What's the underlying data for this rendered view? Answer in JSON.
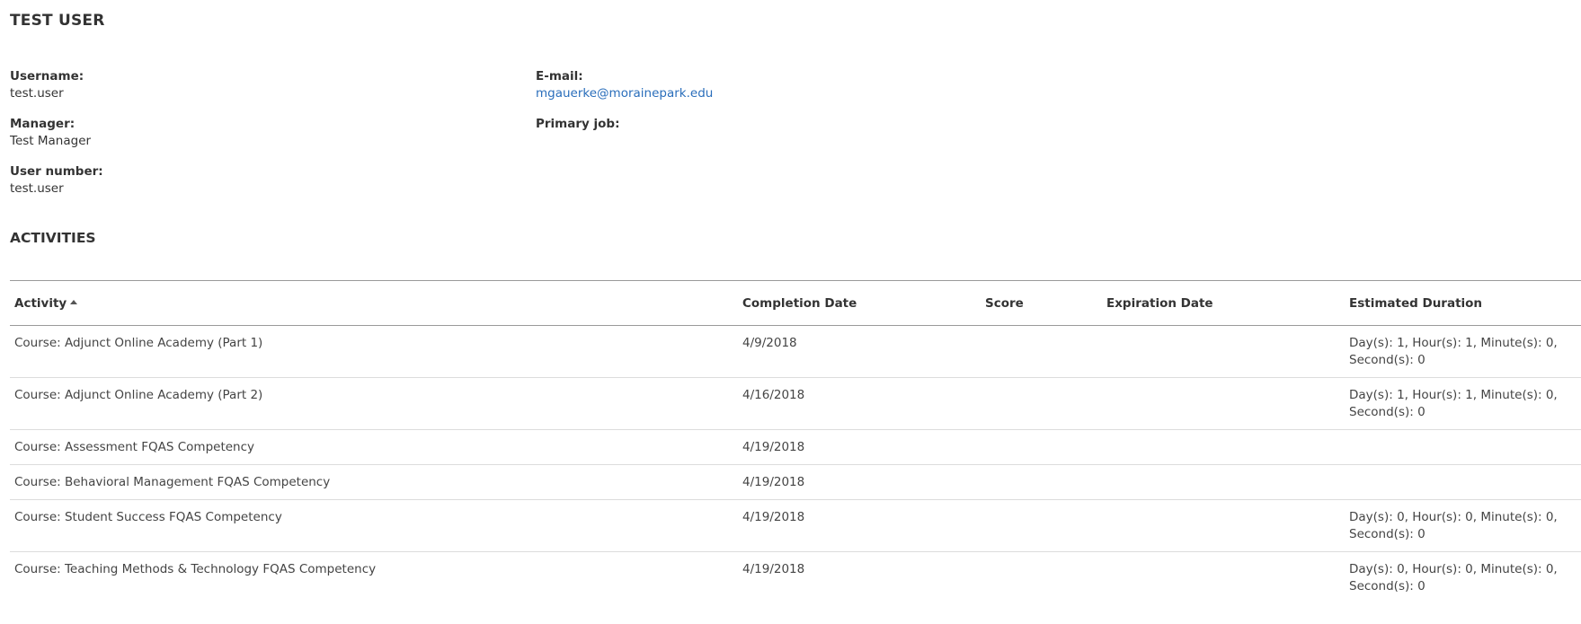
{
  "user": {
    "display_name": "TEST USER"
  },
  "profile": {
    "username_label": "Username:",
    "username_value": "test.user",
    "manager_label": "Manager:",
    "manager_value": "Test Manager",
    "user_number_label": "User number:",
    "user_number_value": "test.user",
    "email_label": "E-mail:",
    "email_value": "mgauerke@morainepark.edu",
    "primary_job_label": "Primary job:",
    "primary_job_value": ""
  },
  "activities": {
    "section_title": "ACTIVITIES",
    "columns": [
      "Activity",
      "Completion Date",
      "Score",
      "Expiration Date",
      "Estimated Duration"
    ],
    "sort": {
      "column": "Activity",
      "direction": "ascending"
    },
    "rows": [
      {
        "activity": "Course: Adjunct Online Academy (Part 1)",
        "completion_date": "4/9/2018",
        "score": "",
        "expiration_date": "",
        "estimated_duration": "Day(s): 1, Hour(s): 1, Minute(s): 0, Second(s): 0"
      },
      {
        "activity": "Course: Adjunct Online Academy (Part 2)",
        "completion_date": "4/16/2018",
        "score": "",
        "expiration_date": "",
        "estimated_duration": "Day(s): 1, Hour(s): 1, Minute(s): 0, Second(s): 0"
      },
      {
        "activity": "Course: Assessment FQAS Competency",
        "completion_date": "4/19/2018",
        "score": "",
        "expiration_date": "",
        "estimated_duration": ""
      },
      {
        "activity": "Course: Behavioral Management FQAS Competency",
        "completion_date": "4/19/2018",
        "score": "",
        "expiration_date": "",
        "estimated_duration": ""
      },
      {
        "activity": "Course: Student Success FQAS Competency",
        "completion_date": "4/19/2018",
        "score": "",
        "expiration_date": "",
        "estimated_duration": "Day(s): 0, Hour(s): 0, Minute(s): 0, Second(s): 0"
      },
      {
        "activity": "Course: Teaching Methods & Technology FQAS Competency",
        "completion_date": "4/19/2018",
        "score": "",
        "expiration_date": "",
        "estimated_duration": "Day(s): 0, Hour(s): 0, Minute(s): 0, Second(s): 0"
      }
    ]
  },
  "colors": {
    "text": "#333333",
    "link": "#2a6ebb",
    "divider": "#9a9a9a",
    "row_divider": "#dcdcdc"
  }
}
